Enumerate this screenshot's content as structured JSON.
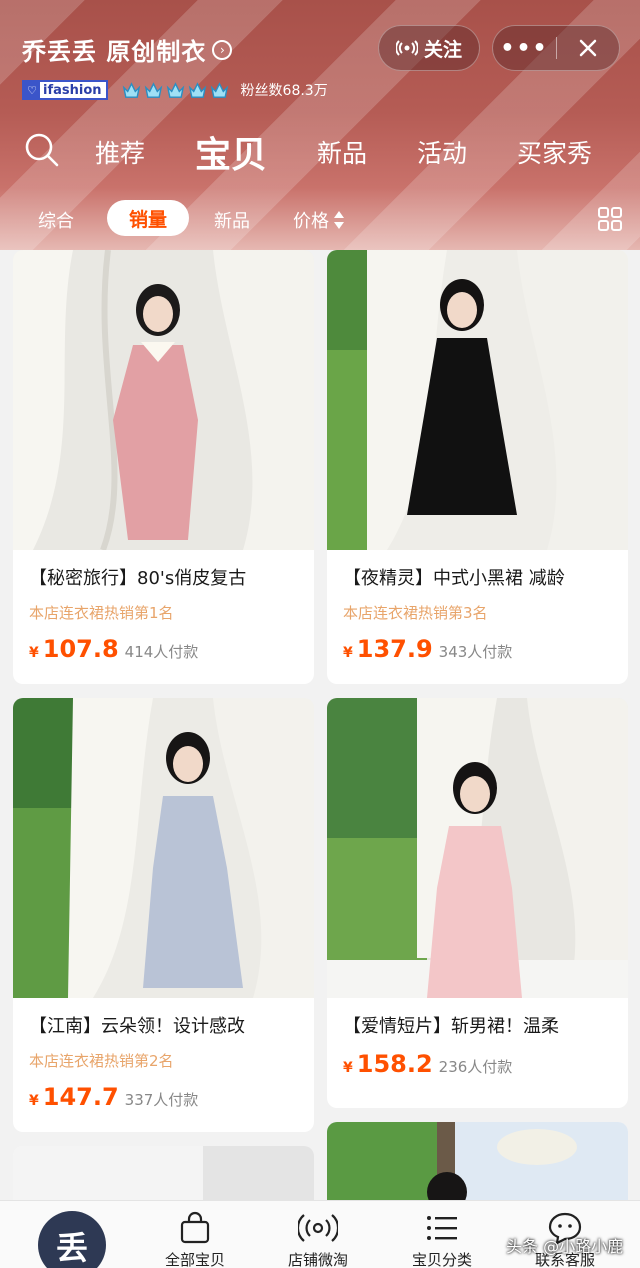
{
  "header": {
    "shop_name": "乔丢丢 原创制衣",
    "follow_label": "关注",
    "more_label": "•••",
    "badge": "ifashion",
    "fans_text": "粉丝数68.3万",
    "crown_count": 5
  },
  "nav": {
    "tabs": [
      {
        "label": "推荐"
      },
      {
        "label": "宝贝",
        "active": true
      },
      {
        "label": "新品"
      },
      {
        "label": "活动"
      },
      {
        "label": "买家秀"
      }
    ]
  },
  "sort": {
    "items": [
      {
        "label": "综合"
      },
      {
        "label": "销量",
        "active": true
      },
      {
        "label": "新品"
      },
      {
        "label": "价格"
      }
    ]
  },
  "products": [
    {
      "title": "【秘密旅行】80's俏皮复古",
      "rank": "本店连衣裙热销第1名",
      "yen": "¥",
      "price": "107.8",
      "buyers": "414人付款",
      "dress_color": "#e2a0a4"
    },
    {
      "title": "【夜精灵】中式小黑裙 减龄",
      "rank": "本店连衣裙热销第3名",
      "yen": "¥",
      "price": "137.9",
      "buyers": "343人付款",
      "dress_color": "#111111"
    },
    {
      "title": "【江南】云朵领！设计感改",
      "rank": "本店连衣裙热销第2名",
      "yen": "¥",
      "price": "147.7",
      "buyers": "337人付款",
      "dress_color": "#b9c3d6"
    },
    {
      "title": "【爱情短片】斩男裙！温柔",
      "rank": "",
      "yen": "¥",
      "price": "158.2",
      "buyers": "236人付款",
      "dress_color": "#f3c6c8"
    }
  ],
  "bottom_bar": {
    "logo_text": "丢",
    "items": [
      {
        "label": "全部宝贝",
        "icon": "shopping-bag-icon"
      },
      {
        "label": "店铺微淘",
        "icon": "broadcast-icon"
      },
      {
        "label": "宝贝分类",
        "icon": "list-icon"
      },
      {
        "label": "联系客服",
        "icon": "chat-icon"
      }
    ]
  },
  "watermark": "头条 @小路小鹿",
  "colors": {
    "accent": "#ff5000",
    "rank": "#e8a56b",
    "header_bg": "#b55c55"
  }
}
